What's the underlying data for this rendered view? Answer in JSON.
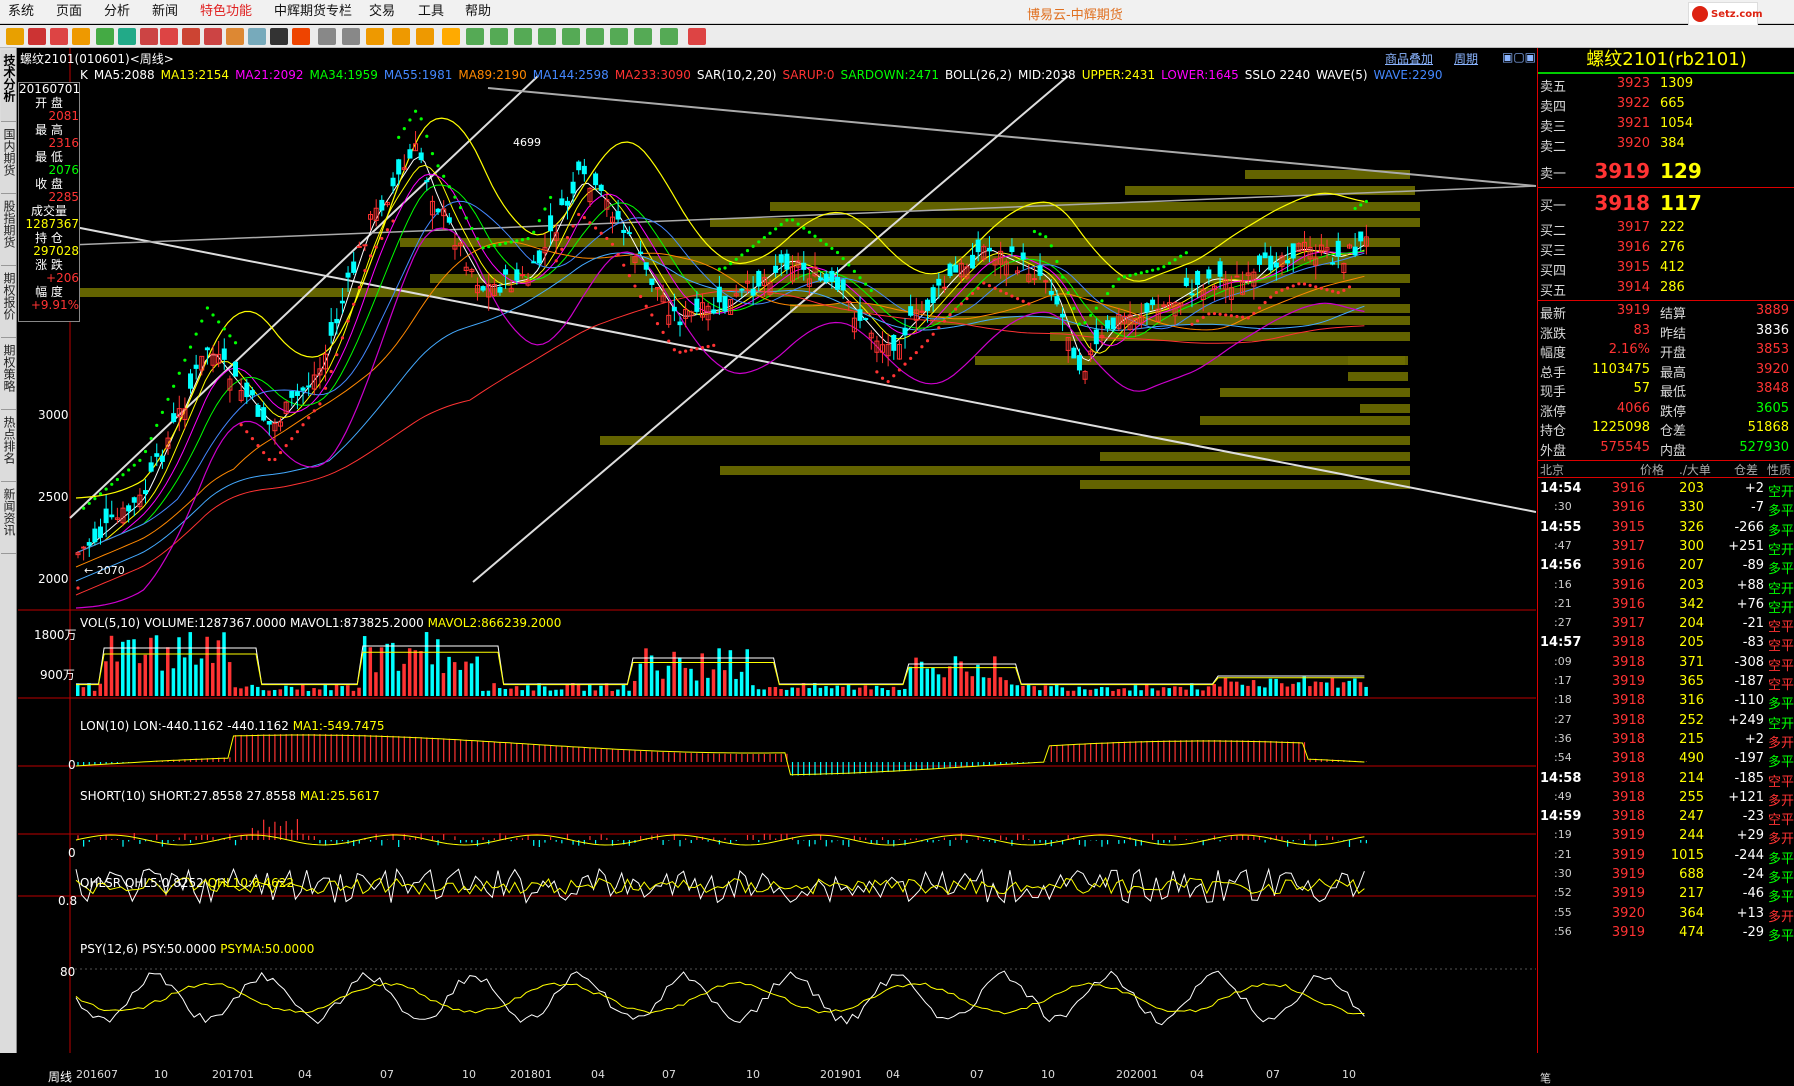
{
  "menu": {
    "items": [
      "系统",
      "页面",
      "分析",
      "新闻",
      "特色功能",
      "中辉期货专栏",
      "交易",
      "工具",
      "帮助"
    ],
    "active": "特色功能"
  },
  "app_title": "博易云-中辉期货",
  "logo_text": "Setz.com",
  "left_tabs": [
    "技术分析",
    "国内期货",
    "股指期货",
    "期权报价",
    "期权策略",
    "热点排名",
    "新闻资讯"
  ],
  "chart": {
    "header": "螺纹2101(010601)<周线>",
    "links": {
      "overlay": "商品叠加",
      "period": "周期"
    },
    "ma_line": [
      {
        "t": "K",
        "c": "#ffffff"
      },
      {
        "t": "MA5:2088",
        "c": "#ffffff"
      },
      {
        "t": "MA13:2154",
        "c": "#ffff00"
      },
      {
        "t": "MA21:2092",
        "c": "#ff00ff"
      },
      {
        "t": "MA34:1959",
        "c": "#00ff00"
      },
      {
        "t": "MA55:1981",
        "c": "#4488ff"
      },
      {
        "t": "MA89:2190",
        "c": "#ff8800"
      },
      {
        "t": "MA144:2598",
        "c": "#4488ff"
      },
      {
        "t": "MA233:3090",
        "c": "#ff3333"
      },
      {
        "t": "SAR(10,2,20)",
        "c": "#ffffff"
      },
      {
        "t": "SARUP:0",
        "c": "#ff3333"
      },
      {
        "t": "SARDOWN:2471",
        "c": "#00ff00"
      },
      {
        "t": "BOLL(26,2)",
        "c": "#ffffff"
      },
      {
        "t": "MID:2038",
        "c": "#ffffff"
      },
      {
        "t": "UPPER:2431",
        "c": "#ffff00"
      },
      {
        "t": "LOWER:1645",
        "c": "#ff00ff"
      },
      {
        "t": "SSLO 2240",
        "c": "#ffffff"
      },
      {
        "t": "WAVE(5)",
        "c": "#ffffff"
      },
      {
        "t": "WAVE:2290",
        "c": "#4488ff"
      }
    ],
    "info_box": {
      "date": "20160701",
      "open_label": "开 盘",
      "open": "2081",
      "high_label": "最 高",
      "high": "2316",
      "low_label": "最 低",
      "low": "2076",
      "close_label": "收 盘",
      "close": "2285",
      "vol_label": "成交量",
      "vol": "1287367",
      "oi_label": "持 仓",
      "oi": "297028",
      "chg_label": "涨 跌",
      "chg": "+206",
      "pct_label": "幅 度",
      "pct": "+9.91%"
    },
    "price_axis": [
      "3000",
      "2500",
      "2000"
    ],
    "price_marks": {
      "peak": "4699",
      "low": "2070"
    },
    "panels": {
      "vol": {
        "title": "VOL(5,10)",
        "v1": "VOLUME:1287367.0000",
        "v2": "MAVOL1:873825.2000",
        "v3": "MAVOL2:866239.2000",
        "axis": [
          "1800万",
          "900万"
        ]
      },
      "lon": {
        "title": "LON(10)",
        "v1": "LON:-440.1162",
        "v2": "-440.1162",
        "v3": "MA1:-549.7475",
        "axis": [
          "0"
        ]
      },
      "short": {
        "title": "SHORT(10)",
        "v1": "SHORT:27.8558",
        "v2": "27.8558",
        "v3": "MA1:25.5617",
        "axis": [
          "0"
        ]
      },
      "qhlsr": {
        "title": "QHLSR",
        "v1": "QHL5:0.8252",
        "v2": "QHL10:0.4622",
        "axis": [
          "0.8"
        ]
      },
      "psy": {
        "title": "PSY(12,6)",
        "v1": "PSY:50.0000",
        "v2": "PSYMA:50.0000",
        "axis": [
          "80"
        ]
      }
    },
    "x_axis": {
      "label": "周线",
      "ticks": [
        "201607",
        "10",
        "201701",
        "04",
        "07",
        "10",
        "201801",
        "04",
        "07",
        "10",
        "201901",
        "04",
        "07",
        "10",
        "202001",
        "04",
        "07",
        "10"
      ]
    },
    "colors": {
      "up": "#ff3333",
      "down": "#00ffff",
      "vp": "#6e6e00"
    }
  },
  "quote": {
    "title": "螺纹2101(rb2101)",
    "asks": [
      {
        "l": "卖五",
        "p": "3923",
        "v": "1309"
      },
      {
        "l": "卖四",
        "p": "3922",
        "v": "665"
      },
      {
        "l": "卖三",
        "p": "3921",
        "v": "1054"
      },
      {
        "l": "卖二",
        "p": "3920",
        "v": "384"
      }
    ],
    "ask1": {
      "l": "卖一",
      "p": "3919",
      "v": "129"
    },
    "bid1": {
      "l": "买一",
      "p": "3918",
      "v": "117"
    },
    "bids": [
      {
        "l": "买二",
        "p": "3917",
        "v": "222"
      },
      {
        "l": "买三",
        "p": "3916",
        "v": "276"
      },
      {
        "l": "买四",
        "p": "3915",
        "v": "412"
      },
      {
        "l": "买五",
        "p": "3914",
        "v": "286"
      }
    ],
    "stats": [
      {
        "l1": "最新",
        "v1": "3919",
        "c1": "#ff3333",
        "l2": "结算",
        "v2": "3889",
        "c2": "#ff3333"
      },
      {
        "l1": "涨跌",
        "v1": "83",
        "c1": "#ff3333",
        "l2": "昨结",
        "v2": "3836",
        "c2": "#ffffff"
      },
      {
        "l1": "幅度",
        "v1": "2.16%",
        "c1": "#ff3333",
        "l2": "开盘",
        "v2": "3853",
        "c2": "#ff3333"
      },
      {
        "l1": "总手",
        "v1": "1103475",
        "c1": "#ffff00",
        "l2": "最高",
        "v2": "3920",
        "c2": "#ff3333"
      },
      {
        "l1": "现手",
        "v1": "57",
        "c1": "#ffff00",
        "l2": "最低",
        "v2": "3848",
        "c2": "#ff3333"
      },
      {
        "l1": "涨停",
        "v1": "4066",
        "c1": "#ff3333",
        "l2": "跌停",
        "v2": "3605",
        "c2": "#00ff00"
      },
      {
        "l1": "持仓",
        "v1": "1225098",
        "c1": "#ffff00",
        "l2": "仓差",
        "v2": "51868",
        "c2": "#ffff00"
      },
      {
        "l1": "外盘",
        "v1": "575545",
        "c1": "#ff3333",
        "l2": "内盘",
        "v2": "527930",
        "c2": "#00ff00"
      }
    ],
    "tick_header": [
      "北京",
      "价格",
      "./大单",
      "仓差",
      "性质"
    ],
    "ticks": [
      {
        "t": "14:54",
        "p": "3916",
        "v": "203",
        "d": "+2",
        "n": "空开",
        "c": "#00ff00"
      },
      {
        "t": ":30",
        "p": "3916",
        "v": "330",
        "d": "-7",
        "n": "多平",
        "c": "#00ff00"
      },
      {
        "t": "14:55",
        "p": "3915",
        "v": "326",
        "d": "-266",
        "n": "多平",
        "c": "#00ff00"
      },
      {
        "t": ":47",
        "p": "3917",
        "v": "300",
        "d": "+251",
        "n": "空开",
        "c": "#00ff00"
      },
      {
        "t": "14:56",
        "p": "3916",
        "v": "207",
        "d": "-89",
        "n": "多平",
        "c": "#00ff00"
      },
      {
        "t": ":16",
        "p": "3916",
        "v": "203",
        "d": "+88",
        "n": "空开",
        "c": "#00ff00"
      },
      {
        "t": ":21",
        "p": "3916",
        "v": "342",
        "d": "+76",
        "n": "空开",
        "c": "#00ff00"
      },
      {
        "t": ":27",
        "p": "3917",
        "v": "204",
        "d": "-21",
        "n": "空平",
        "c": "#ff3333"
      },
      {
        "t": "14:57",
        "p": "3918",
        "v": "205",
        "d": "-83",
        "n": "空平",
        "c": "#ff3333"
      },
      {
        "t": ":09",
        "p": "3918",
        "v": "371",
        "d": "-308",
        "n": "空平",
        "c": "#ff3333"
      },
      {
        "t": ":17",
        "p": "3919",
        "v": "365",
        "d": "-187",
        "n": "空平",
        "c": "#ff3333"
      },
      {
        "t": ":18",
        "p": "3918",
        "v": "316",
        "d": "-110",
        "n": "多平",
        "c": "#00ff00"
      },
      {
        "t": ":27",
        "p": "3918",
        "v": "252",
        "d": "+249",
        "n": "空开",
        "c": "#00ff00"
      },
      {
        "t": ":36",
        "p": "3918",
        "v": "215",
        "d": "+2",
        "n": "多开",
        "c": "#ff3333"
      },
      {
        "t": ":54",
        "p": "3918",
        "v": "490",
        "d": "-197",
        "n": "多平",
        "c": "#00ff00"
      },
      {
        "t": "14:58",
        "p": "3918",
        "v": "214",
        "d": "-185",
        "n": "空平",
        "c": "#ff3333"
      },
      {
        "t": ":49",
        "p": "3918",
        "v": "255",
        "d": "+121",
        "n": "多开",
        "c": "#ff3333"
      },
      {
        "t": "14:59",
        "p": "3918",
        "v": "247",
        "d": "-23",
        "n": "空平",
        "c": "#ff3333"
      },
      {
        "t": ":19",
        "p": "3919",
        "v": "244",
        "d": "+29",
        "n": "多开",
        "c": "#ff3333"
      },
      {
        "t": ":21",
        "p": "3919",
        "v": "1015",
        "d": "-244",
        "n": "多平",
        "c": "#00ff00"
      },
      {
        "t": ":30",
        "p": "3919",
        "v": "688",
        "d": "-24",
        "n": "多平",
        "c": "#00ff00"
      },
      {
        "t": ":52",
        "p": "3919",
        "v": "217",
        "d": "-46",
        "n": "多平",
        "c": "#00ff00"
      },
      {
        "t": ":55",
        "p": "3920",
        "v": "364",
        "d": "+13",
        "n": "多开",
        "c": "#ff3333"
      },
      {
        "t": ":56",
        "p": "3919",
        "v": "474",
        "d": "-29",
        "n": "多平",
        "c": "#00ff00"
      }
    ],
    "footer": "笔"
  }
}
